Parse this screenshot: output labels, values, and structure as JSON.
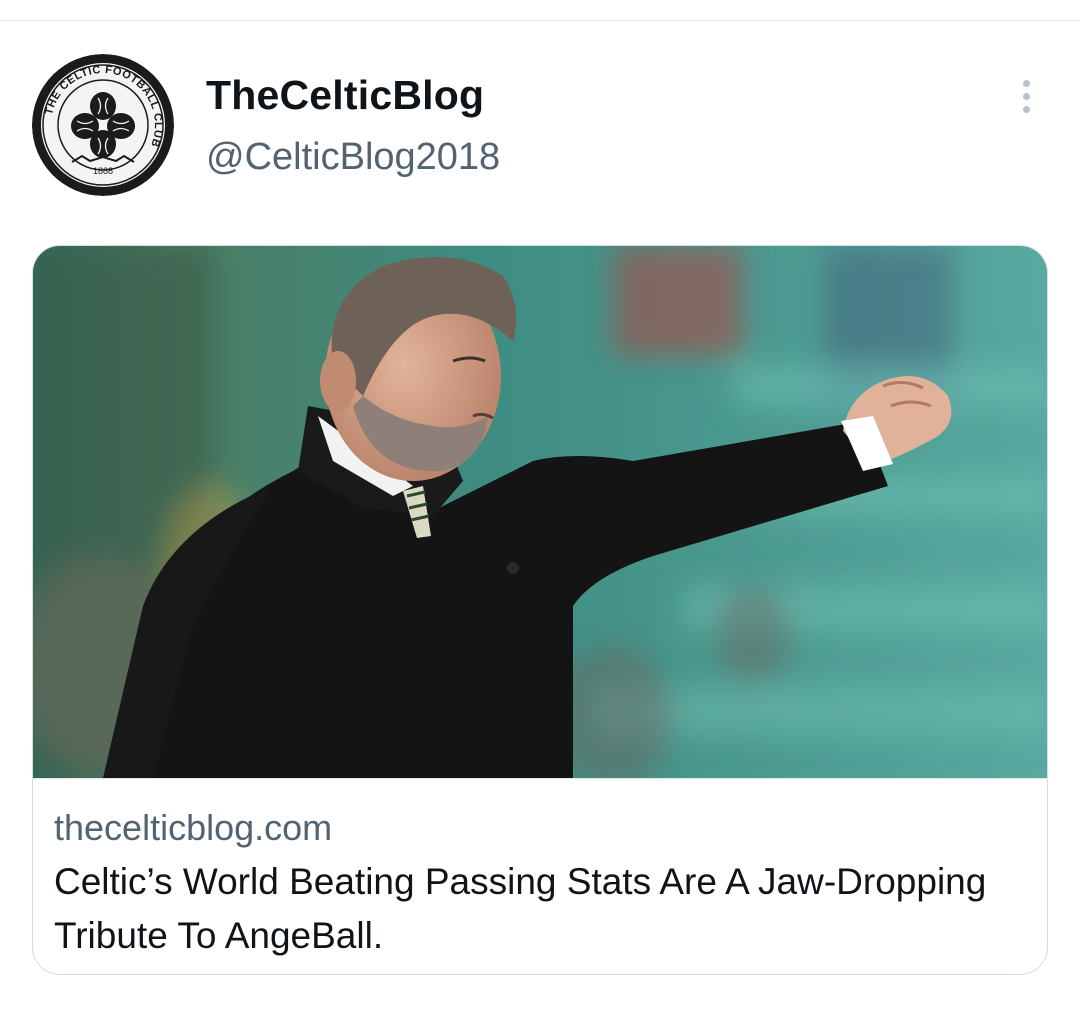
{
  "tweet": {
    "display_name": "TheCelticBlog",
    "handle": "@CelticBlog2018",
    "more_icon": "more-vertical-icon"
  },
  "avatar": {
    "ring_text": "THE CELTIC FOOTBALL CLUB",
    "year": "1888"
  },
  "card": {
    "domain": "thecelticblog.com",
    "title": "Celtic’s World Beating Passing Stats Are A Jaw-Dropping Tribute To AngeBall."
  },
  "colors": {
    "text_primary": "#0f1419",
    "text_secondary": "#536471",
    "border": "#d7dde2",
    "stadium_teal": "#4fa49a",
    "jacket": "#141414"
  }
}
